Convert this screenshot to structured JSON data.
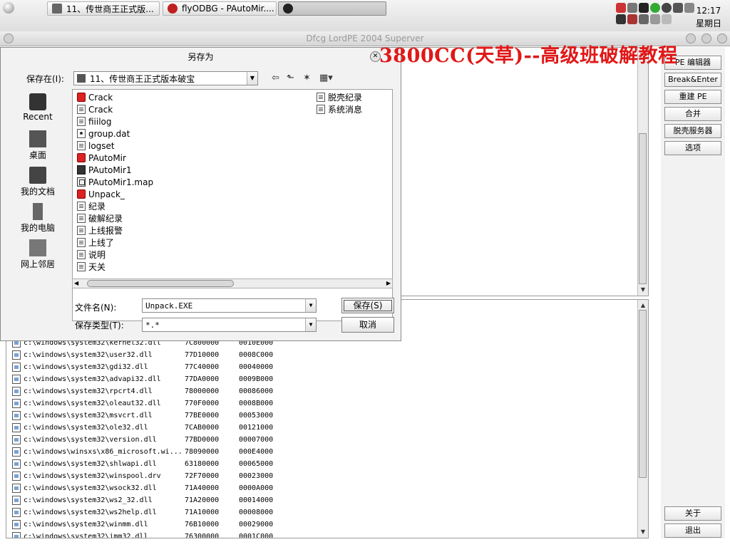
{
  "taskbar": {
    "tasks": [
      {
        "label": "11、传世商王正式版..."
      },
      {
        "label": "flyODBG - PAutoMir...."
      },
      {
        "label": ""
      }
    ],
    "clock_time": "12:17",
    "clock_day": "星期日"
  },
  "lordpe": {
    "window_title": "Dfcg LordPE 2004 Superver",
    "watermark": "3800CC(天草)--高级班破解教程",
    "side_buttons": [
      "PE 编辑器",
      "Break&Enter",
      "重建 PE",
      "合并",
      "脱壳服务器",
      "选项"
    ],
    "side_buttons_bottom": [
      "关于",
      "退出"
    ],
    "modules": [
      {
        "path": "c:\\windows\\system32\\kernel32.dll",
        "base": "7C800000",
        "size": "0010E000"
      },
      {
        "path": "c:\\windows\\system32\\user32.dll",
        "base": "77D10000",
        "size": "0008C000"
      },
      {
        "path": "c:\\windows\\system32\\gdi32.dll",
        "base": "77C40000",
        "size": "00040000"
      },
      {
        "path": "c:\\windows\\system32\\advapi32.dll",
        "base": "77DA0000",
        "size": "0009B000"
      },
      {
        "path": "c:\\windows\\system32\\rpcrt4.dll",
        "base": "78000000",
        "size": "00086000"
      },
      {
        "path": "c:\\windows\\system32\\oleaut32.dll",
        "base": "770F0000",
        "size": "0008B000"
      },
      {
        "path": "c:\\windows\\system32\\msvcrt.dll",
        "base": "77BE0000",
        "size": "00053000"
      },
      {
        "path": "c:\\windows\\system32\\ole32.dll",
        "base": "7CAB0000",
        "size": "00121000"
      },
      {
        "path": "c:\\windows\\system32\\version.dll",
        "base": "77BD0000",
        "size": "00007000"
      },
      {
        "path": "c:\\windows\\winsxs\\x86_microsoft.wi...",
        "base": "78090000",
        "size": "000E4000"
      },
      {
        "path": "c:\\windows\\system32\\shlwapi.dll",
        "base": "63180000",
        "size": "00065000"
      },
      {
        "path": "c:\\windows\\system32\\winspool.drv",
        "base": "72F70000",
        "size": "00023000"
      },
      {
        "path": "c:\\windows\\system32\\wsock32.dll",
        "base": "71A40000",
        "size": "0000A000"
      },
      {
        "path": "c:\\windows\\system32\\ws2_32.dll",
        "base": "71A20000",
        "size": "00014000"
      },
      {
        "path": "c:\\windows\\system32\\ws2help.dll",
        "base": "71A10000",
        "size": "00008000"
      },
      {
        "path": "c:\\windows\\system32\\winmm.dll",
        "base": "76B10000",
        "size": "00029000"
      },
      {
        "path": "c:\\windows\\system32\\imm32.dll",
        "base": "76300000",
        "size": "0001C000"
      }
    ]
  },
  "dialog": {
    "title": "另存为",
    "save_in_label": "保存在(I):",
    "save_in_value": "11、传世商王正式版本破宝",
    "places": [
      "Recent",
      "桌面",
      "我的文档",
      "我的电脑",
      "网上邻居"
    ],
    "files_col1": [
      {
        "name": "Crack",
        "icon": "app-icon"
      },
      {
        "name": "Crack",
        "icon": "doc-icon"
      },
      {
        "name": "fiiilog",
        "icon": "doc-icon"
      },
      {
        "name": "group.dat",
        "icon": "dat-icon"
      },
      {
        "name": "logset",
        "icon": "doc-icon"
      },
      {
        "name": "PAutoMir",
        "icon": "app-icon"
      },
      {
        "name": "PAutoMir1",
        "icon": "bin-icon"
      },
      {
        "name": "PAutoMir1.map",
        "icon": "map-icon"
      },
      {
        "name": "Unpack_",
        "icon": "app-icon"
      },
      {
        "name": "纪录",
        "icon": "doc-icon"
      },
      {
        "name": "破解纪录",
        "icon": "doc-icon"
      },
      {
        "name": "上线报警",
        "icon": "doc-icon"
      },
      {
        "name": "上线了",
        "icon": "doc-icon"
      },
      {
        "name": "说明",
        "icon": "doc-icon"
      },
      {
        "name": "天关",
        "icon": "doc-icon"
      }
    ],
    "files_col2": [
      {
        "name": "脱壳纪录",
        "icon": "doc-icon"
      },
      {
        "name": "系统消息",
        "icon": "doc-icon"
      }
    ],
    "filename_label": "文件名(N):",
    "filename_value": "Unpack.EXE",
    "filetype_label": "保存类型(T):",
    "filetype_value": "*.*",
    "save_button": "保存(S)",
    "cancel_button": "取消"
  }
}
